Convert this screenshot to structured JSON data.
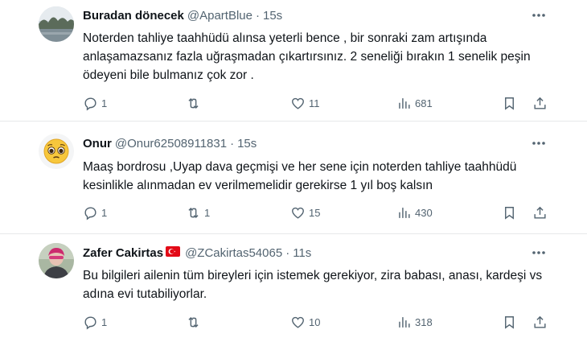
{
  "tweets": [
    {
      "name": "Buradan dönecek",
      "handle": "@ApartBlue",
      "separator": "·",
      "time": "15s",
      "avatar": "landscape-photo",
      "text": "Noterden tahliye taahhüdü alınsa yeterli bence , bir sonraki zam artışında anlaşamazsanız fazla uğraşmadan çıkartırsınız. 2 seneliği bırakın 1 senelik peşin ödeyeni bile bulmanız çok zor .",
      "replies": "1",
      "retweets": "",
      "likes": "11",
      "views": "681"
    },
    {
      "name": "Onur",
      "handle": "@Onur62508911831",
      "separator": "·",
      "time": "15s",
      "avatar": "pleading-face-emoji",
      "text": "Maaş bordrosu ,Uyap dava geçmişi ve her sene için noterden tahliye taahhüdü kesinlikle alınmadan ev verilmemelidir gerekirse 1 yıl boş kalsın",
      "replies": "1",
      "retweets": "1",
      "likes": "15",
      "views": "430"
    },
    {
      "name": "Zafer Cakirtas",
      "handle": "@ZCakirtas54065",
      "separator": "·",
      "time": "11s",
      "avatar": "person-photo",
      "flag": "turkey-flag",
      "text": "Bu bilgileri ailenin tüm bireyleri için istemek gerekiyor, zira babası, anası, kardeşi vs adına evi tutabiliyorlar.",
      "replies": "1",
      "retweets": "",
      "likes": "10",
      "views": "318"
    }
  ],
  "colors": {
    "text": "#0f1419",
    "muted": "#536471",
    "divider": "#e7e9ea",
    "flag_red": "#e30a17"
  }
}
